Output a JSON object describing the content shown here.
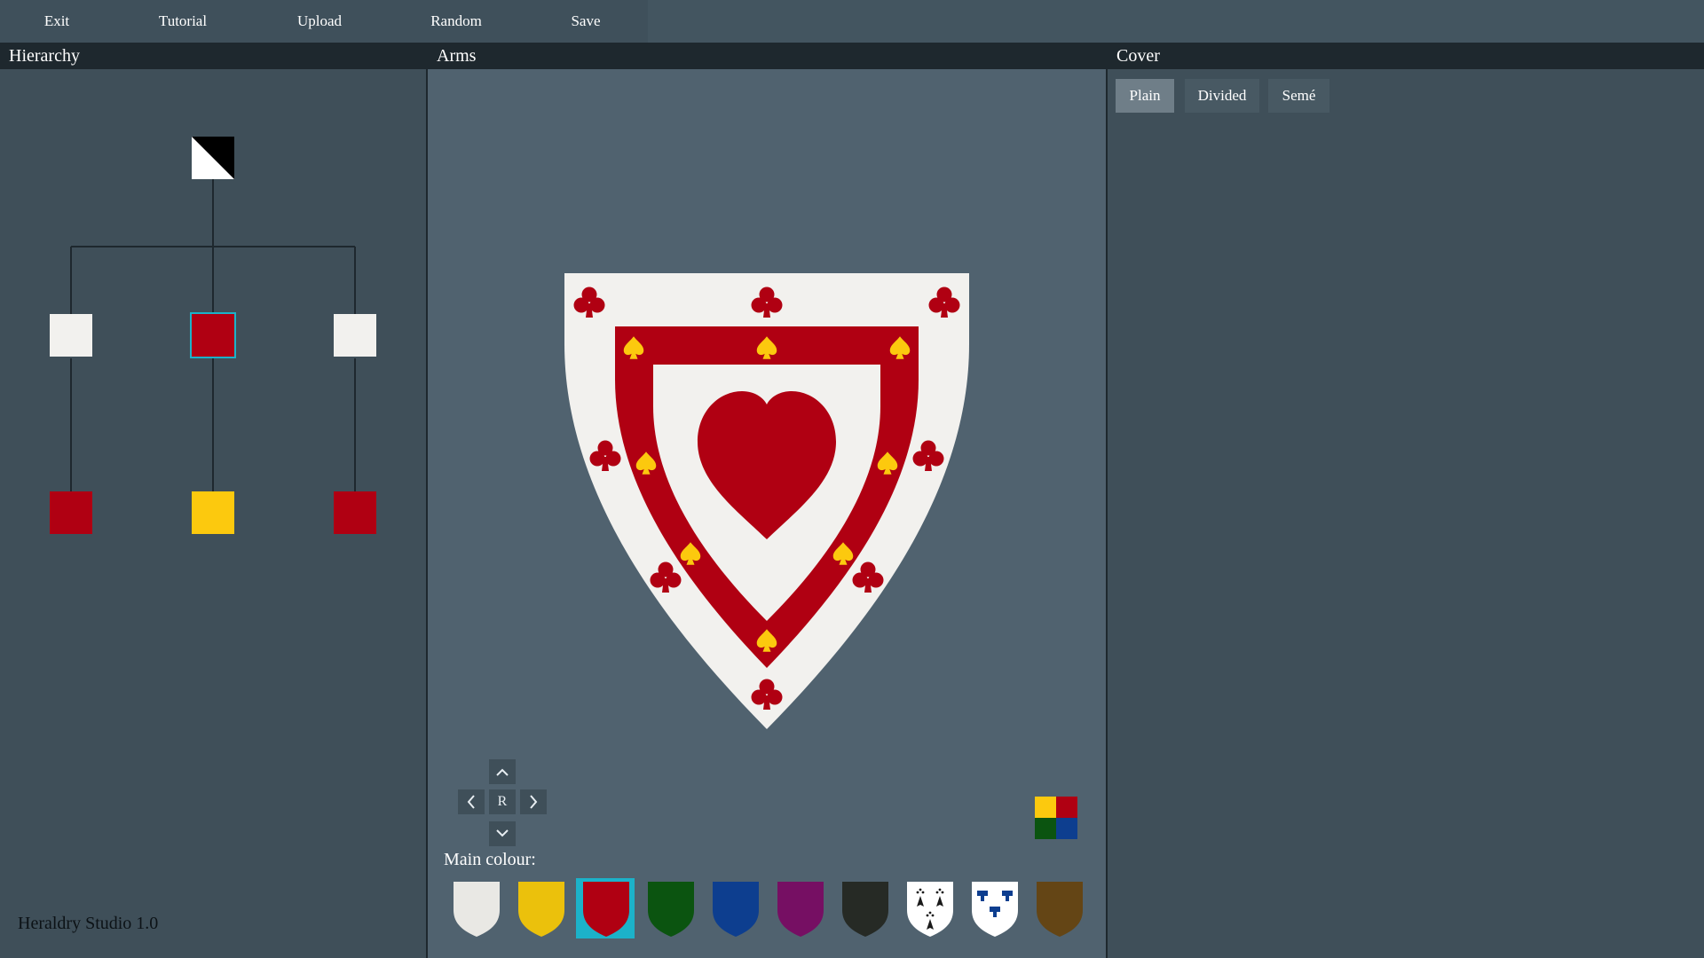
{
  "menu": {
    "exit": "Exit",
    "tutorial": "Tutorial",
    "upload": "Upload",
    "random": "Random",
    "save": "Save"
  },
  "panels": {
    "hierarchy": "Hierarchy",
    "arms": "Arms",
    "cover": "Cover"
  },
  "hierarchy": {
    "root": {
      "fill": "party-per-bend-white-black"
    },
    "level1": [
      {
        "color": "#f2f1ee",
        "selected": false
      },
      {
        "color": "#b00012",
        "selected": true
      },
      {
        "color": "#f2f1ee",
        "selected": false
      }
    ],
    "level2": [
      {
        "color": "#b00012"
      },
      {
        "color": "#fcc90e"
      },
      {
        "color": "#b00012"
      }
    ]
  },
  "arms": {
    "field_color": "#f2f1ee",
    "bordure_color": "#b00012",
    "inner_color": "#f2f1ee",
    "heart_color": "#b00012",
    "bordure_charge": "club",
    "bordure_charge_color": "#b00012",
    "orle_charge": "spade",
    "orle_charge_color": "#fcc90e",
    "nav": {
      "reset": "R"
    }
  },
  "colours": {
    "label": "Main colour:",
    "swatches": [
      {
        "name": "argent",
        "color": "#e9e8e4",
        "selected": false
      },
      {
        "name": "or",
        "color": "#ebc10c",
        "selected": false
      },
      {
        "name": "gules",
        "color": "#b00012",
        "selected": true
      },
      {
        "name": "vert",
        "color": "#0b5410",
        "selected": false
      },
      {
        "name": "azure",
        "color": "#0d3e8f",
        "selected": false
      },
      {
        "name": "purpure",
        "color": "#760f63",
        "selected": false
      },
      {
        "name": "sable",
        "color": "#262a25",
        "selected": false
      },
      {
        "name": "ermine",
        "color": "#ffffff",
        "selected": false
      },
      {
        "name": "vair",
        "color": "#ffffff",
        "selected": false
      },
      {
        "name": "tenne",
        "color": "#644515",
        "selected": false
      }
    ],
    "selection_color": "#1cb2c9"
  },
  "cover": {
    "tabs": [
      "Plain",
      "Divided",
      "Semé"
    ],
    "active": "Plain"
  },
  "footer": {
    "version": "Heraldry Studio 1.0"
  }
}
